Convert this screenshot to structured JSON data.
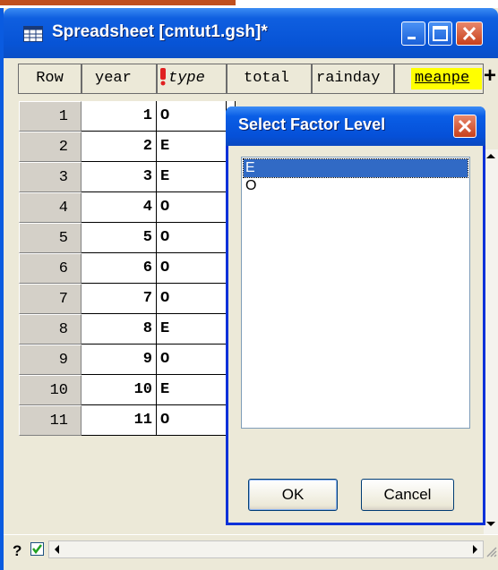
{
  "window": {
    "title": "Spreadsheet [cmtut1.gsh]*",
    "title_icon": "spreadsheet-icon"
  },
  "columns": {
    "row": "Row",
    "year": "year",
    "type": "type",
    "total": "total",
    "rainday": "rainday",
    "meanpe": "meanpe",
    "add": "+"
  },
  "rows": [
    {
      "row": "1",
      "year": "1",
      "type": "O"
    },
    {
      "row": "2",
      "year": "2",
      "type": "E"
    },
    {
      "row": "3",
      "year": "3",
      "type": "E"
    },
    {
      "row": "4",
      "year": "4",
      "type": "O"
    },
    {
      "row": "5",
      "year": "5",
      "type": "O"
    },
    {
      "row": "6",
      "year": "6",
      "type": "O"
    },
    {
      "row": "7",
      "year": "7",
      "type": "O"
    },
    {
      "row": "8",
      "year": "8",
      "type": "E"
    },
    {
      "row": "9",
      "year": "9",
      "type": "O"
    },
    {
      "row": "10",
      "year": "10",
      "type": "E"
    },
    {
      "row": "11",
      "year": "11",
      "type": "O"
    }
  ],
  "statusbar": {
    "help": "?"
  },
  "dialog": {
    "title": "Select Factor Level",
    "items": [
      "E",
      "O"
    ],
    "selected": "E",
    "ok_label": "OK",
    "cancel_label": "Cancel"
  },
  "colors": {
    "titlebar": "#0754d6",
    "highlight_column": "#ffff00",
    "selection": "#316ac5",
    "accent": "#c0501e"
  }
}
